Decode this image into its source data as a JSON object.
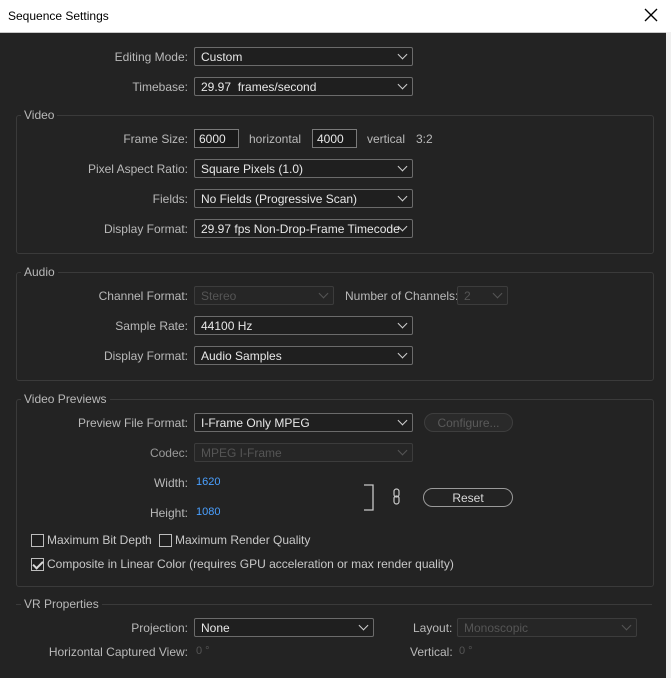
{
  "window": {
    "title": "Sequence Settings"
  },
  "general": {
    "editing_mode": {
      "label": "Editing Mode:",
      "value": "Custom"
    },
    "timebase": {
      "label": "Timebase:",
      "value": "29.97  frames/second"
    }
  },
  "video": {
    "title": "Video",
    "frame_size": {
      "label": "Frame Size:",
      "width": "6000",
      "horizontal": "horizontal",
      "height": "4000",
      "vertical": "vertical",
      "ratio": "3:2"
    },
    "pixel_aspect_ratio": {
      "label": "Pixel Aspect Ratio:",
      "value": "Square Pixels (1.0)"
    },
    "fields": {
      "label": "Fields:",
      "value": "No Fields (Progressive Scan)"
    },
    "display_format": {
      "label": "Display Format:",
      "value": "29.97 fps Non-Drop-Frame Timecode"
    }
  },
  "audio": {
    "title": "Audio",
    "channel_format": {
      "label": "Channel Format:",
      "value": "Stereo"
    },
    "number_of_channels": {
      "label": "Number of Channels:",
      "value": "2"
    },
    "sample_rate": {
      "label": "Sample Rate:",
      "value": "44100 Hz"
    },
    "display_format": {
      "label": "Display Format:",
      "value": "Audio Samples"
    }
  },
  "video_previews": {
    "title": "Video Previews",
    "preview_file_format": {
      "label": "Preview File Format:",
      "value": "I-Frame Only MPEG"
    },
    "configure_button": "Configure...",
    "codec": {
      "label": "Codec:",
      "value": "MPEG I-Frame"
    },
    "width": {
      "label": "Width:",
      "value": "1620"
    },
    "height": {
      "label": "Height:",
      "value": "1080"
    },
    "reset_button": "Reset",
    "max_bit_depth": {
      "label": "Maximum Bit Depth",
      "checked": false
    },
    "max_render_quality": {
      "label": "Maximum Render Quality",
      "checked": false
    },
    "composite_linear": {
      "label": "Composite in Linear Color (requires GPU acceleration or max render quality)",
      "checked": true
    }
  },
  "vr_properties": {
    "title": "VR Properties",
    "projection": {
      "label": "Projection:",
      "value": "None"
    },
    "layout": {
      "label": "Layout:",
      "value": "Monoscopic"
    },
    "horizontal_captured_view": {
      "label": "Horizontal Captured View:",
      "value": "0 °"
    },
    "vertical": {
      "label": "Vertical:",
      "value": "0 °"
    }
  },
  "colors": {
    "link_blue": "#4aa0ff",
    "background": "#232323"
  }
}
